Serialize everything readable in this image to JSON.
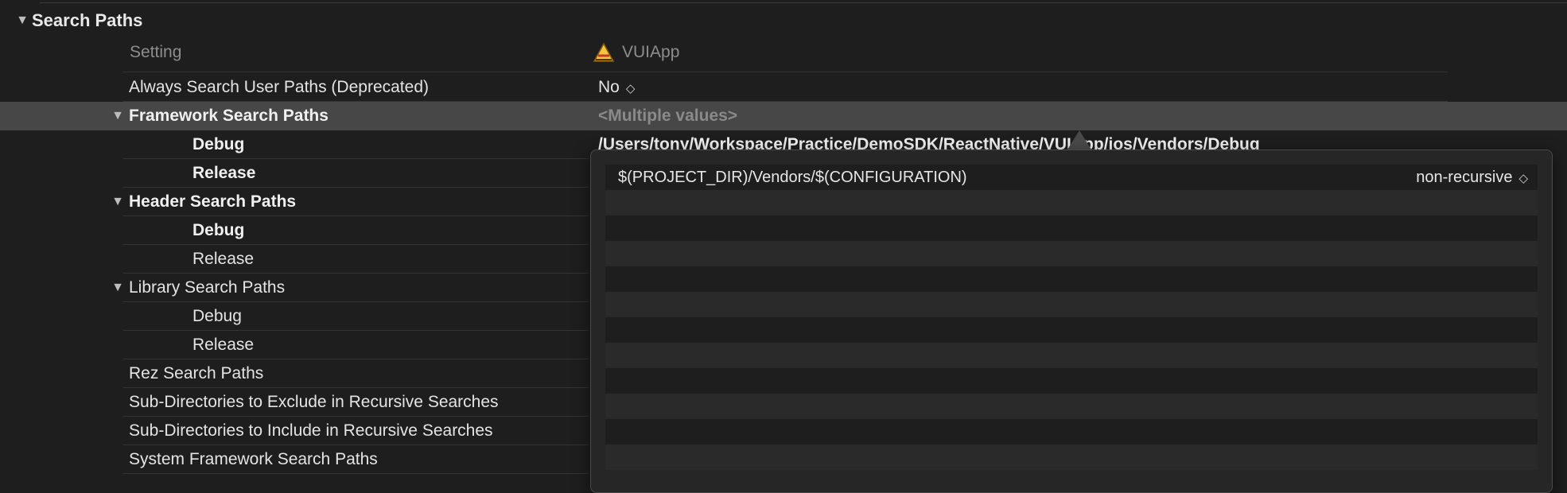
{
  "section": {
    "title": "Search Paths"
  },
  "columns": {
    "setting": "Setting",
    "target": "VUIApp"
  },
  "rows": [
    {
      "label": "Always Search User Paths (Deprecated)",
      "value": "No"
    },
    {
      "label": "Framework Search Paths",
      "value": "<Multiple values>"
    },
    {
      "label": "Debug",
      "value": "/Users/tony/Workspace/Practice/DemoSDK/ReactNative/VUIApp/ios/Vendors/Debug"
    },
    {
      "label": "Release"
    },
    {
      "label": "Header Search Paths"
    },
    {
      "label": "Debug"
    },
    {
      "label": "Release"
    },
    {
      "label": "Library Search Paths"
    },
    {
      "label": "Debug"
    },
    {
      "label": "Release"
    },
    {
      "label": "Rez Search Paths"
    },
    {
      "label": "Sub-Directories to Exclude in Recursive Searches"
    },
    {
      "label": "Sub-Directories to Include in Recursive Searches"
    },
    {
      "label": "System Framework Search Paths"
    }
  ],
  "popover": {
    "entries": [
      {
        "path": "$(PROJECT_DIR)/Vendors/$(CONFIGURATION)",
        "recursion": "non-recursive"
      }
    ]
  },
  "icons": {
    "disclosure": "disclosure-triangle-icon",
    "stepper": "stepper-icon",
    "app": "app-target-icon"
  },
  "colors": {
    "background": "#1e1e1e",
    "selected_row": "#474747",
    "popover": "#262626"
  }
}
